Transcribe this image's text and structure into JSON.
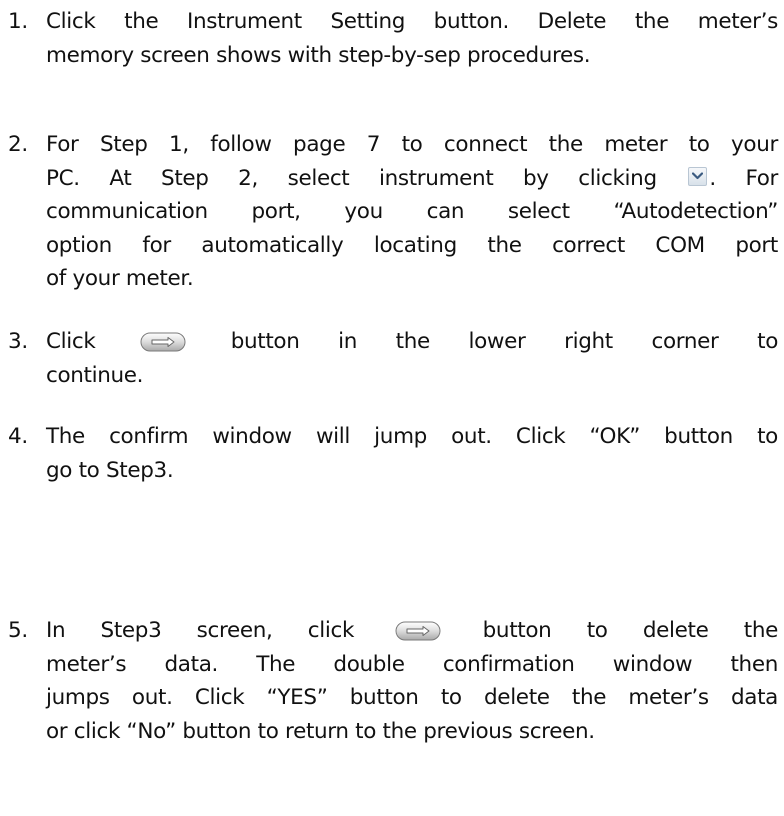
{
  "items": [
    {
      "number": "1.",
      "lines": [
        "Click the Instrument Setting button. Delete the meter’s",
        "memory screen shows with step-by-sep procedures."
      ]
    },
    {
      "number": "2.",
      "lines": [
        "For Step 1, follow page 7 to connect the meter to your",
        "PC. At Step 2, select instrument by clicking",
        ". For",
        "communication port, you can select “Autodetection”",
        "option for automatically locating the correct COM port",
        "of your meter."
      ],
      "icon": "dropdown-arrow-icon"
    },
    {
      "number": "3.",
      "lines": [
        "Click",
        "button in the lower right corner to",
        "continue."
      ],
      "icon": "next-arrow-button-icon"
    },
    {
      "number": "4.",
      "lines": [
        "The confirm window will jump out. Click “OK” button to",
        "go to Step3."
      ]
    },
    {
      "number": "5.",
      "lines": [
        "In Step3 screen, click",
        "button to delete the",
        "meter’s data. The double confirmation window then",
        "jumps out. Click “YES” button to delete the meter’s data",
        "or click “No” button to return to the previous screen."
      ],
      "icon": "next-arrow-button-icon"
    }
  ]
}
